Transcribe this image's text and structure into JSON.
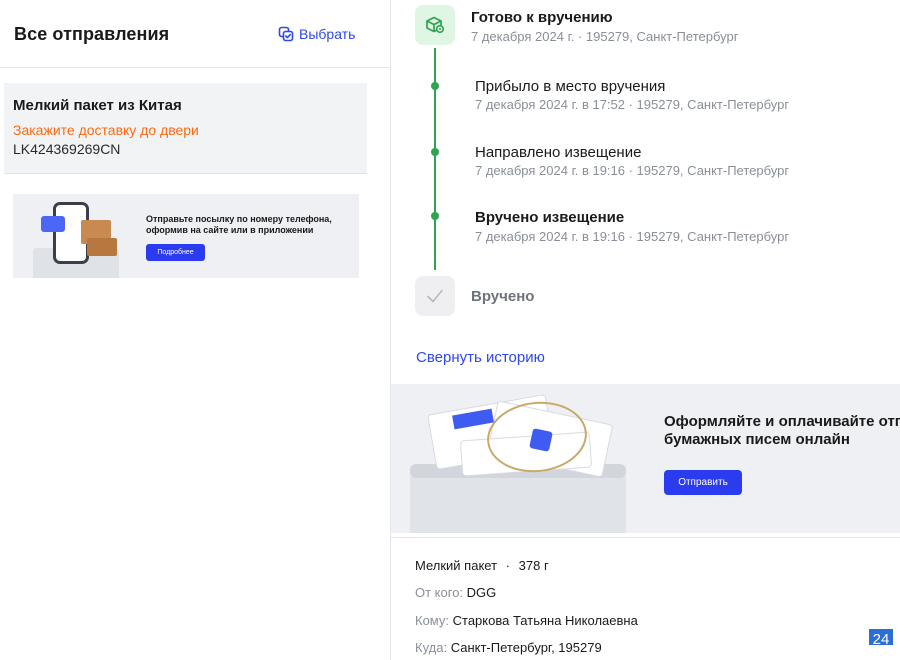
{
  "sidebar": {
    "title": "Все отправления",
    "select_label": "Выбрать",
    "parcel": {
      "name": "Мелкий пакет из Китая",
      "cta": "Закажите доставку до двери",
      "track": "LK424369269CN"
    },
    "banner": {
      "text": "Отправьте посылку по номеру телефона, оформив на сайте или в приложении",
      "button": "Подробнее"
    }
  },
  "history": {
    "ready": {
      "title": "Готово к вручению",
      "subtitle": "7 декабря 2024 г. · 195279, Санкт-Петербург"
    },
    "events": [
      {
        "title": "Прибыло в место вручения",
        "subtitle": "7 декабря 2024 г. в 17:52 · 195279, Санкт-Петербург"
      },
      {
        "title": "Направлено извещение",
        "subtitle": "7 декабря 2024 г. в 19:16 · 195279, Санкт-Петербург"
      },
      {
        "title": "Вручено извещение",
        "subtitle": "7 декабря 2024 г. в 19:16 · 195279, Санкт-Петербург"
      }
    ],
    "delivered_label": "Вручено",
    "collapse_label": "Свернуть историю"
  },
  "promo": {
    "text_line1": "Оформляйте и оплачивайте отп",
    "text_line2": "бумажных писем онлайн",
    "button": "Отправить"
  },
  "details": {
    "type": "Мелкий пакет",
    "separator": "·",
    "weight": "378 г",
    "from_label": "От кого:",
    "from_value": "DGG",
    "to_label": "Кому:",
    "to_value": "Старкова Татьяна Николаевна",
    "where_label": "Куда:",
    "where_value": "Санкт-Петербург, 195279"
  },
  "corner_badge": "24",
  "colors": {
    "accent_blue": "#2b49f0",
    "timeline_green": "#2ea44f",
    "cta_orange": "#ff6a13"
  }
}
